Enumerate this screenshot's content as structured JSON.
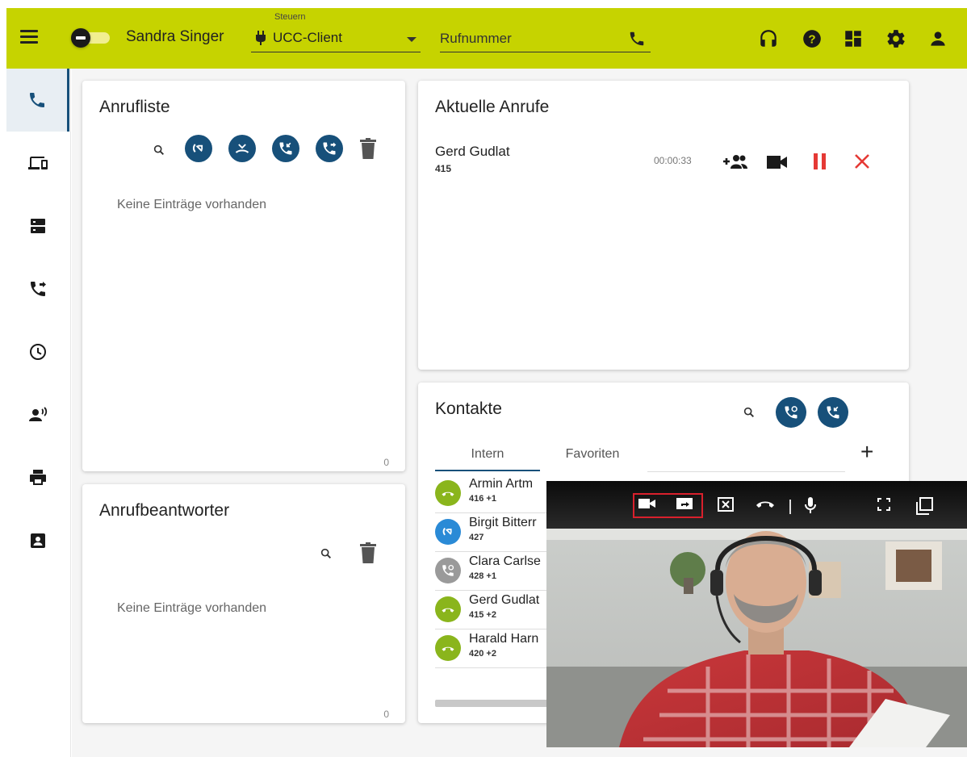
{
  "header": {
    "user_name": "Sandra Singer",
    "control_label": "Steuern",
    "control_value": "UCC-Client",
    "number_placeholder": "Rufnummer",
    "icons": [
      "menu-icon",
      "status-toggle",
      "headset-icon",
      "help-icon",
      "dashboard-icon",
      "gear-icon",
      "user-icon"
    ]
  },
  "sidebar": {
    "items": [
      {
        "icon": "phone-icon",
        "active": true
      },
      {
        "icon": "devices-icon"
      },
      {
        "icon": "server-icon"
      },
      {
        "icon": "call-forward-icon"
      },
      {
        "icon": "clock-icon"
      },
      {
        "icon": "voicemail-person-icon"
      },
      {
        "icon": "printer-icon"
      },
      {
        "icon": "contact-card-icon"
      }
    ]
  },
  "call_list": {
    "title": "Anrufliste",
    "empty": "Keine Einträge vorhanden",
    "count": "0",
    "filters": [
      "outgoing-call-icon",
      "missed-call-icon",
      "incoming-call-icon",
      "forwarded-call-icon"
    ]
  },
  "answering_machine": {
    "title": "Anrufbeantworter",
    "empty": "Keine Einträge vorhanden",
    "count": "0"
  },
  "current_calls": {
    "title": "Aktuelle Anrufe",
    "calls": [
      {
        "name": "Gerd Gudlat",
        "ext": "415",
        "duration": "00:00:33"
      }
    ]
  },
  "contacts": {
    "title": "Kontakte",
    "tabs": [
      "Intern",
      "Favoriten"
    ],
    "active_tab": "Intern",
    "items": [
      {
        "name": "Armin Artm",
        "ext": "416 +1",
        "color": "#8ab51c",
        "status": "busy"
      },
      {
        "name": "Birgit Bitterr",
        "ext": "427",
        "color": "#2a8ad6",
        "status": "outgoing"
      },
      {
        "name": "Clara Carlse",
        "ext": "428 +1",
        "color": "#9a9a9a",
        "status": "forward"
      },
      {
        "name": "Gerd Gudlat",
        "ext": "415 +2",
        "color": "#8ab51c",
        "status": "busy"
      },
      {
        "name": "Harald Harn",
        "ext": "420 +2",
        "color": "#8ab51c",
        "status": "busy"
      }
    ]
  },
  "video_call": {
    "toolbar": [
      "camera-icon",
      "screen-share-icon",
      "close-video-icon",
      "hangup-icon",
      "microphone-icon",
      "fullscreen-icon",
      "popout-icon"
    ],
    "highlight_color": "#d9202c"
  },
  "colors": {
    "topbar": "#c6d300",
    "primary": "#17507a",
    "danger": "#e53935",
    "busy_green": "#8ab51c"
  }
}
